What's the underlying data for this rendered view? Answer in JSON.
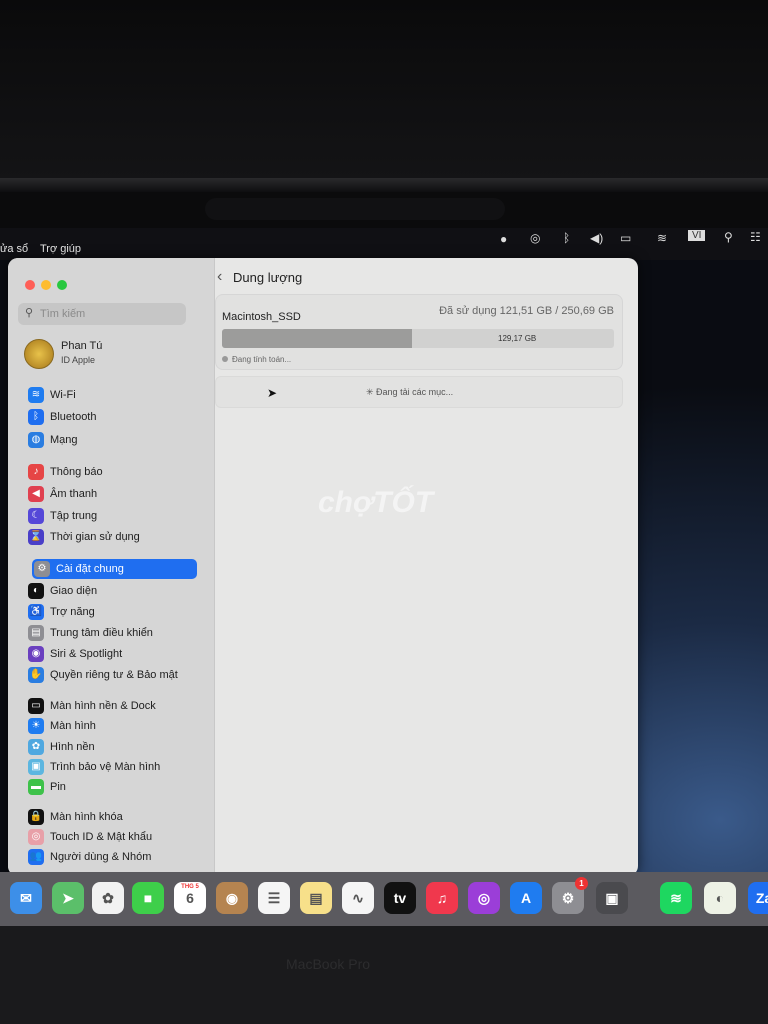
{
  "menubar": {
    "items": [
      "ửa sổ",
      "Trợ giúp"
    ],
    "status_icons": [
      "siri-icon",
      "screen-share-icon",
      "bluetooth-icon",
      "volume-icon",
      "battery-icon",
      "wifi-icon",
      "input-source-icon",
      "search-icon",
      "control-center-icon"
    ],
    "input_source": "VI"
  },
  "sidebar": {
    "search_placeholder": "Tìm kiếm",
    "profile": {
      "name": "Phan Tú",
      "subtitle": "ID Apple"
    },
    "items": [
      {
        "label": "Wi-Fi",
        "icon": "wifi-icon",
        "color": "#1f7cf0",
        "glyph": "≋"
      },
      {
        "label": "Bluetooth",
        "icon": "bluetooth-icon",
        "color": "#1f6ef0",
        "glyph": "ᛒ"
      },
      {
        "label": "Mạng",
        "icon": "globe-icon",
        "color": "#2a7de1",
        "glyph": "◍"
      },
      {
        "label": "Thông báo",
        "icon": "bell-icon",
        "color": "#e64545",
        "glyph": "♪"
      },
      {
        "label": "Âm thanh",
        "icon": "speaker-icon",
        "color": "#e0404f",
        "glyph": "◀"
      },
      {
        "label": "Tập trung",
        "icon": "moon-icon",
        "color": "#5548d8",
        "glyph": "☾"
      },
      {
        "label": "Thời gian sử dụng",
        "icon": "hourglass-icon",
        "color": "#4a3fc8",
        "glyph": "⌛"
      },
      {
        "label": "Cài đặt chung",
        "icon": "gear-icon",
        "color": "#8e8e93",
        "glyph": "⚙",
        "selected": true
      },
      {
        "label": "Giao diện",
        "icon": "appearance-icon",
        "color": "#111111",
        "glyph": "◐"
      },
      {
        "label": "Trợ năng",
        "icon": "accessibility-icon",
        "color": "#1f6ef0",
        "glyph": "♿"
      },
      {
        "label": "Trung tâm điều khiển",
        "icon": "control-center-icon",
        "color": "#8e8e93",
        "glyph": "▤"
      },
      {
        "label": "Siri & Spotlight",
        "icon": "siri-icon",
        "color": "#6a3fbf",
        "glyph": "◉"
      },
      {
        "label": "Quyền riêng tư & Bảo mật",
        "icon": "hand-icon",
        "color": "#2a7de1",
        "glyph": "✋"
      },
      {
        "label": "Màn hình nền & Dock",
        "icon": "dock-icon",
        "color": "#111111",
        "glyph": "▭"
      },
      {
        "label": "Màn hình",
        "icon": "display-icon",
        "color": "#1f7cf0",
        "glyph": "☀"
      },
      {
        "label": "Hình nền",
        "icon": "wallpaper-icon",
        "color": "#4fa8e0",
        "glyph": "✿"
      },
      {
        "label": "Trình bảo vệ Màn hình",
        "icon": "screensaver-icon",
        "color": "#5cb6e0",
        "glyph": "▣"
      },
      {
        "label": "Pin",
        "icon": "battery-icon",
        "color": "#3ec24a",
        "glyph": "▬"
      },
      {
        "label": "Màn hình khóa",
        "icon": "lock-icon",
        "color": "#111111",
        "glyph": "🔒"
      },
      {
        "label": "Touch ID & Mật khẩu",
        "icon": "fingerprint-icon",
        "color": "#e8a0a8",
        "glyph": "◎"
      },
      {
        "label": "Người dùng & Nhóm",
        "icon": "users-icon",
        "color": "#1f6ef0",
        "glyph": "👥"
      }
    ]
  },
  "main": {
    "title": "Dung lượng",
    "disk_name": "Macintosh_SSD",
    "used_text": "Đã sử dụng 121,51 GB / 250,69 GB",
    "used_fraction": 0.485,
    "free_label": "129,17 GB",
    "calculating": "Đang tính toán...",
    "loading": "Đang tải các mục..."
  },
  "watermark": "chợTỐT",
  "dock": {
    "apps": [
      {
        "name": "mail",
        "label": "✉",
        "color": "#3d8fe8"
      },
      {
        "name": "maps",
        "label": "➤",
        "color": "#5bbf6a"
      },
      {
        "name": "photos",
        "label": "✿",
        "color": "#f2f2f2"
      },
      {
        "name": "facetime",
        "label": "■",
        "color": "#3ecf4a"
      },
      {
        "name": "calendar",
        "label": "6",
        "month": "THG 5",
        "color": "#ffffff"
      },
      {
        "name": "contacts",
        "label": "◉",
        "color": "#b58450"
      },
      {
        "name": "reminders",
        "label": "☰",
        "color": "#f5f5f5"
      },
      {
        "name": "notes",
        "label": "▤",
        "color": "#f7e08a"
      },
      {
        "name": "freeform",
        "label": "∿",
        "color": "#f5f5f5"
      },
      {
        "name": "tv",
        "label": "tv",
        "color": "#111111"
      },
      {
        "name": "music",
        "label": "♫",
        "color": "#f0384d"
      },
      {
        "name": "podcasts",
        "label": "◎",
        "color": "#9b3ed8"
      },
      {
        "name": "app-store",
        "label": "A",
        "color": "#1f7cf0"
      },
      {
        "name": "system-settings",
        "label": "⚙",
        "color": "#8e8e93",
        "badge": "1"
      },
      {
        "name": "screenshot",
        "label": "▣",
        "color": "#4a4a4e"
      },
      {
        "name": "spotify",
        "label": "≋",
        "color": "#1ed760"
      },
      {
        "name": "coccoc",
        "label": "◐",
        "color": "#eef2e6"
      },
      {
        "name": "zalo",
        "label": "Za",
        "color": "#1f6ef0"
      }
    ]
  },
  "bezel": {
    "brand": "MacBook Pro"
  }
}
